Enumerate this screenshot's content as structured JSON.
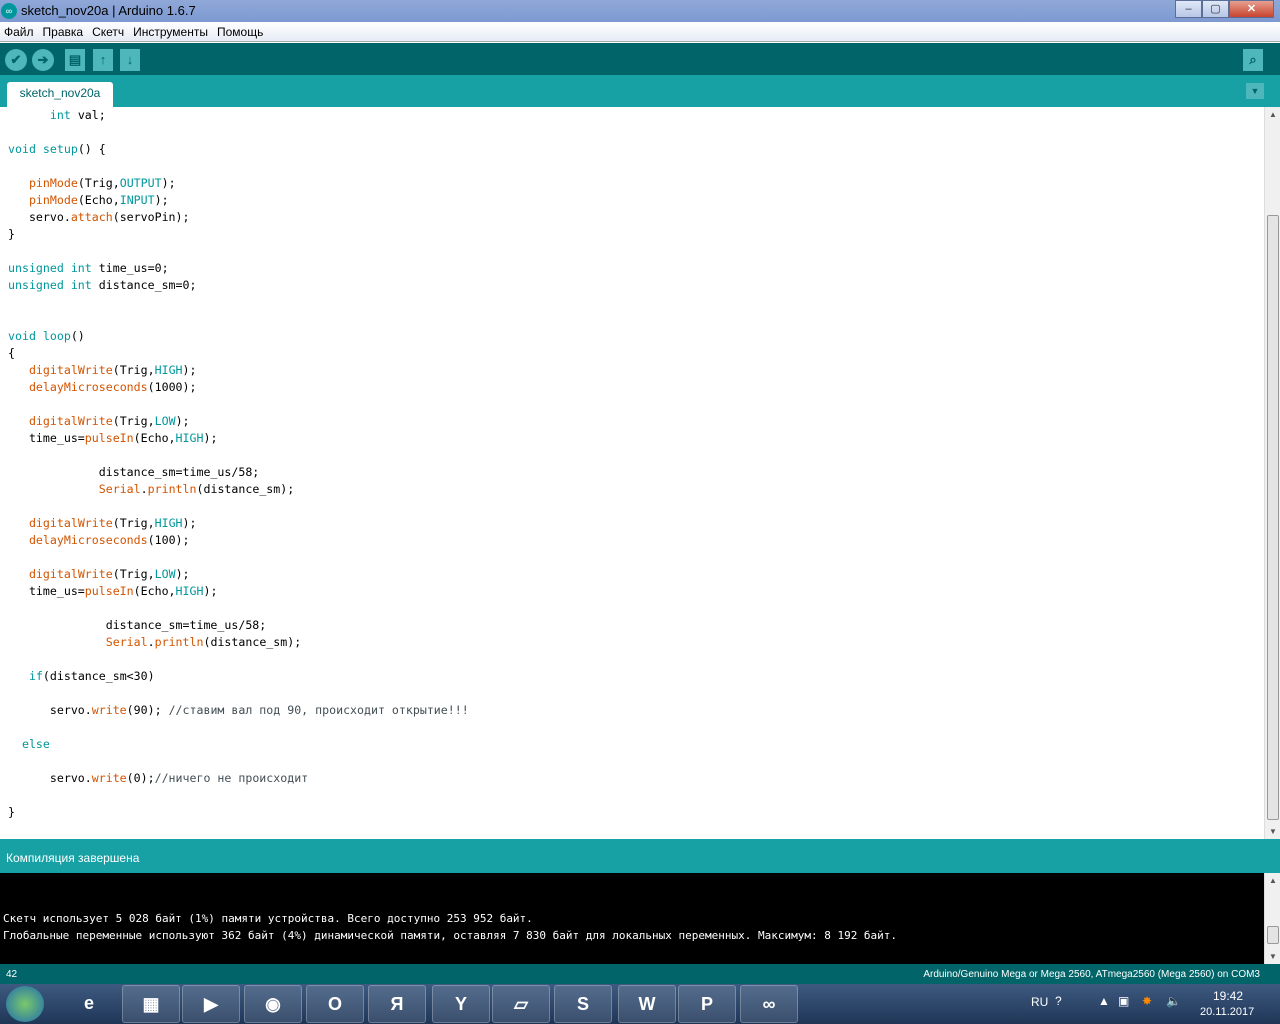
{
  "window": {
    "title": "sketch_nov20a | Arduino 1.6.7",
    "minimize": "‒",
    "maximize": "▢",
    "close": "✕"
  },
  "menu": [
    "Файл",
    "Правка",
    "Скетч",
    "Инструменты",
    "Помощь"
  ],
  "toolbar": {
    "verify": "✔",
    "upload": "➔",
    "new": "▤",
    "open": "↑",
    "save": "↓",
    "serial_monitor": "⌕"
  },
  "tabs": [
    {
      "label": "sketch_nov20a"
    }
  ],
  "tab_menu": "▼",
  "code": {
    "lines": [
      [
        [
          "      ",
          " "
        ],
        [
          "int",
          "kw"
        ],
        [
          " val;",
          ""
        ]
      ],
      [],
      [
        [
          "void",
          "kw"
        ],
        [
          " ",
          ""
        ],
        [
          "setup",
          "kw"
        ],
        [
          "() {",
          ""
        ]
      ],
      [],
      [
        [
          "   ",
          ""
        ],
        [
          "pinMode",
          "fn"
        ],
        [
          "(Trig,",
          ""
        ],
        [
          "OUTPUT",
          "kw"
        ],
        [
          ");",
          ""
        ]
      ],
      [
        [
          "   ",
          ""
        ],
        [
          "pinMode",
          "fn"
        ],
        [
          "(Echo,",
          ""
        ],
        [
          "INPUT",
          "kw"
        ],
        [
          ");",
          ""
        ]
      ],
      [
        [
          "   servo.",
          ""
        ],
        [
          "attach",
          "fn"
        ],
        [
          "(servoPin);",
          ""
        ]
      ],
      [
        [
          "}",
          ""
        ]
      ],
      [],
      [
        [
          "unsigned",
          "kw"
        ],
        [
          " ",
          ""
        ],
        [
          "int",
          "kw"
        ],
        [
          " time_us=0;",
          ""
        ]
      ],
      [
        [
          "unsigned",
          "kw"
        ],
        [
          " ",
          ""
        ],
        [
          "int",
          "kw"
        ],
        [
          " distance_sm=0;",
          ""
        ]
      ],
      [],
      [],
      [
        [
          "void",
          "kw"
        ],
        [
          " ",
          ""
        ],
        [
          "loop",
          "kw"
        ],
        [
          "()",
          ""
        ]
      ],
      [
        [
          "{",
          ""
        ]
      ],
      [
        [
          "   ",
          ""
        ],
        [
          "digitalWrite",
          "fn"
        ],
        [
          "(Trig,",
          ""
        ],
        [
          "HIGH",
          "kw"
        ],
        [
          ");",
          ""
        ]
      ],
      [
        [
          "   ",
          ""
        ],
        [
          "delayMicroseconds",
          "fn"
        ],
        [
          "(1000);",
          ""
        ]
      ],
      [],
      [
        [
          "   ",
          ""
        ],
        [
          "digitalWrite",
          "fn"
        ],
        [
          "(Trig,",
          ""
        ],
        [
          "LOW",
          "kw"
        ],
        [
          ");",
          ""
        ]
      ],
      [
        [
          "   time_us=",
          ""
        ],
        [
          "pulseIn",
          "fn"
        ],
        [
          "(Echo,",
          ""
        ],
        [
          "HIGH",
          "kw"
        ],
        [
          ");",
          ""
        ]
      ],
      [],
      [
        [
          "             distance_sm=time_us/58;",
          ""
        ]
      ],
      [
        [
          "             ",
          ""
        ],
        [
          "Serial",
          "fn"
        ],
        [
          ".",
          ""
        ],
        [
          "println",
          "fn"
        ],
        [
          "(distance_sm);",
          ""
        ]
      ],
      [],
      [
        [
          "   ",
          ""
        ],
        [
          "digitalWrite",
          "fn"
        ],
        [
          "(Trig,",
          ""
        ],
        [
          "HIGH",
          "kw"
        ],
        [
          ");",
          ""
        ]
      ],
      [
        [
          "   ",
          ""
        ],
        [
          "delayMicroseconds",
          "fn"
        ],
        [
          "(100);",
          ""
        ]
      ],
      [],
      [
        [
          "   ",
          ""
        ],
        [
          "digitalWrite",
          "fn"
        ],
        [
          "(Trig,",
          ""
        ],
        [
          "LOW",
          "kw"
        ],
        [
          ");",
          ""
        ]
      ],
      [
        [
          "   time_us=",
          ""
        ],
        [
          "pulseIn",
          "fn"
        ],
        [
          "(Echo,",
          ""
        ],
        [
          "HIGH",
          "kw"
        ],
        [
          ");",
          ""
        ]
      ],
      [],
      [
        [
          "              distance_sm=time_us/58;",
          ""
        ]
      ],
      [
        [
          "              ",
          ""
        ],
        [
          "Serial",
          "fn"
        ],
        [
          ".",
          ""
        ],
        [
          "println",
          "fn"
        ],
        [
          "(distance_sm);",
          ""
        ]
      ],
      [],
      [
        [
          "   ",
          ""
        ],
        [
          "if",
          "kw"
        ],
        [
          "(distance_sm<30)",
          ""
        ]
      ],
      [],
      [
        [
          "      servo.",
          ""
        ],
        [
          "write",
          "fn"
        ],
        [
          "(90); ",
          ""
        ],
        [
          "//ставим вал под 90, происходит открытие!!!",
          "cm"
        ]
      ],
      [],
      [
        [
          "  ",
          ""
        ],
        [
          "else",
          "kw"
        ]
      ],
      [],
      [
        [
          "      servo.",
          ""
        ],
        [
          "write",
          "fn"
        ],
        [
          "(0);",
          ""
        ],
        [
          "//ничего не происходит",
          "cm"
        ]
      ],
      [],
      [
        [
          "}",
          ""
        ]
      ]
    ]
  },
  "status": {
    "message": "Компиляция завершена"
  },
  "console": {
    "lines": [
      "Скетч использует 5 028 байт (1%) памяти устройства. Всего доступно 253 952 байт.",
      "Глобальные переменные используют 362 байт (4%) динамической памяти, оставляя 7 830 байт для локальных переменных. Максимум: 8 192 байт."
    ]
  },
  "footer": {
    "line_number": "42",
    "board": "Arduino/Genuino Mega or Mega 2560, ATmega2560 (Mega 2560) on COM3"
  },
  "taskbar": {
    "apps": [
      {
        "name": "ie",
        "glyph": "e"
      },
      {
        "name": "explorer",
        "glyph": "▦"
      },
      {
        "name": "media-player",
        "glyph": "▶"
      },
      {
        "name": "chrome",
        "glyph": "◉"
      },
      {
        "name": "opera",
        "glyph": "O"
      },
      {
        "name": "yandex",
        "glyph": "Я"
      },
      {
        "name": "yandex-browser",
        "glyph": "Y"
      },
      {
        "name": "sticky-notes",
        "glyph": "▱"
      },
      {
        "name": "skype",
        "glyph": "S"
      },
      {
        "name": "word",
        "glyph": "W"
      },
      {
        "name": "powerpoint",
        "glyph": "P"
      },
      {
        "name": "arduino",
        "glyph": "∞"
      }
    ],
    "lang": "RU",
    "time": "19:42",
    "date": "20.11.2017"
  },
  "colors": {
    "teal_dark": "#006468",
    "teal": "#17a1a5",
    "keyword": "#00979c",
    "function": "#d35400"
  }
}
